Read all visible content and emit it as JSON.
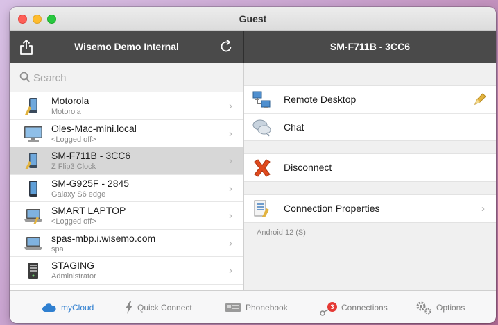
{
  "window": {
    "title": "Guest"
  },
  "left_header": {
    "title": "Wisemo Demo Internal",
    "share_icon": "share-icon",
    "refresh_icon": "refresh-icon"
  },
  "right_header": {
    "title": "SM-F711B - 3CC6"
  },
  "search": {
    "placeholder": "Search"
  },
  "devices": [
    {
      "name": "Motorola",
      "sub": "Motorola",
      "icon": "phone-icon",
      "selected": false
    },
    {
      "name": "Oles-Mac-mini.local",
      "sub": "<Logged off>",
      "icon": "desktop-icon",
      "selected": false
    },
    {
      "name": "SM-F711B - 3CC6",
      "sub": "Z Flip3 Clock",
      "icon": "phone-icon",
      "selected": true
    },
    {
      "name": "SM-G925F - 2845",
      "sub": "Galaxy S6 edge",
      "icon": "phone-icon",
      "selected": false
    },
    {
      "name": "SMART LAPTOP",
      "sub": "<Logged off>",
      "icon": "laptop-icon",
      "selected": false
    },
    {
      "name": "spas-mbp.i.wisemo.com",
      "sub": "spa",
      "icon": "laptop-icon",
      "selected": false
    },
    {
      "name": "STAGING",
      "sub": "Administrator",
      "icon": "server-icon",
      "selected": false
    }
  ],
  "actions": {
    "remote_desktop": "Remote Desktop",
    "chat": "Chat",
    "disconnect": "Disconnect",
    "connection_properties": "Connection Properties",
    "footnote": "Android 12 (S)"
  },
  "tabs": {
    "mycloud": "myCloud",
    "quick_connect": "Quick Connect",
    "phonebook": "Phonebook",
    "connections": "Connections",
    "connections_badge": "3",
    "options": "Options"
  },
  "colors": {
    "accent": "#2f7fd0",
    "header": "#4a4a4a",
    "selected_row": "#d7d7d7",
    "badge": "#e53935"
  }
}
